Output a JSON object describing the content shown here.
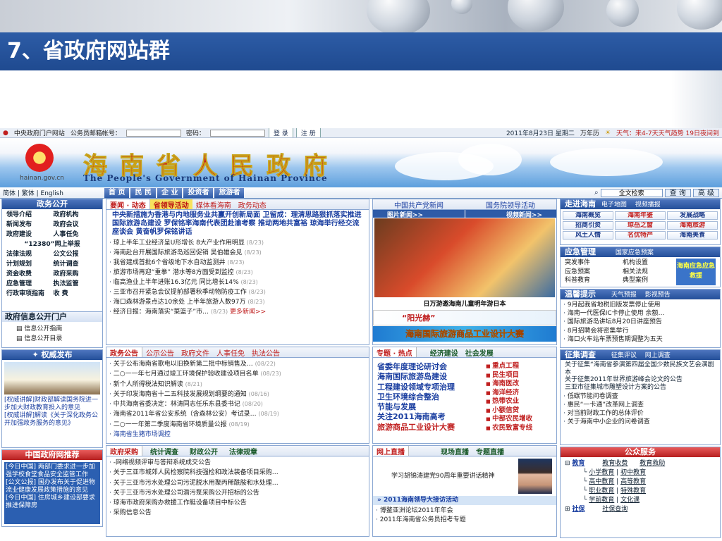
{
  "slide": {
    "title": "7、省政府网站群"
  },
  "topbar": {
    "portal": "中央政府门户网站",
    "account_label": "公务员邮箱帐号：",
    "password_label": "密码：",
    "login": "登 录",
    "register": "注 册",
    "date": "2011年8月23日 星期二",
    "calendar": "万年历",
    "weather": "天气：来4-7天天气趋势 19日夜间到"
  },
  "banner": {
    "url": "hainan.gov.cn",
    "title": "海南省人民政府",
    "subtitle": "The People's Government of Hainan Province"
  },
  "nav": {
    "langs": "简体 | 繁体 | English",
    "tabs": [
      "首 页",
      "民 民",
      "企 业",
      "投资者",
      "旅游者"
    ],
    "search_value": "全文检索",
    "query": "查 询",
    "advanced": "高 级"
  },
  "left": {
    "gov_open": {
      "title": "政务公开",
      "items": [
        "领导介绍",
        "政府机构",
        "新闻发布",
        "政府会议",
        "政府建设",
        "人事任免",
        "“12380”网上举报",
        "",
        "法律法规",
        "公文公报",
        "计划规划",
        "统计调查",
        "资金收费",
        "政府采购",
        "应急管理",
        "执法监管",
        "行政审项指南",
        "收 费"
      ]
    },
    "info_open": {
      "title": "政府信息公开门户",
      "items": [
        "信息公开指南",
        "信息公开目录"
      ]
    },
    "authority": {
      "title": "权威发布",
      "text": "[权威讲解]财政部解读国务院进一步加大财政教育投入的意见",
      "text2": "[权威讲解]解读《关于深化政务公开加强政务服务的意见》"
    },
    "recommend": {
      "title": "中国政府网推荐",
      "text": "[今日中国] 两部门委求进一步加强学校食堂食品安全监管工作",
      "text2": "[公文公报] 国办发布关于促进物流业健康发展政策措施的意见",
      "text3": "[今日中国] 住房城乡建设部要求推进保障房"
    }
  },
  "mid": {
    "news_tabs": {
      "t1": "要闻 · 动态",
      "t2": "省领导活动",
      "t3": "媒体看海南",
      "t4": "政务动态"
    },
    "headline": "中央新措施为香港与内地服务业共赢开创新局面 卫留成：理清思路狠抓落实推进国际旅游岛建设 罗保铭率海南代表团赴渝考察 推动两地共富裕 琼海举行经交流座谈会 黄奋帆罗保铭讲话",
    "news": [
      {
        "t": "琼上半年工业经济呈U形增长 8大产业作用明显",
        "d": "(8/23)"
      },
      {
        "t": "海南赴台开展国际旅游岛巡回促销 吴伯雄会见",
        "d": "(8/23)"
      },
      {
        "t": "我省建成首批6个省级地下水自动监测井",
        "d": "(8/23)"
      },
      {
        "t": "旅游市场再迎“重拳” 潜水等8方面受到监控",
        "d": "(8/23)"
      },
      {
        "t": "临高渔业上半年进账16.3亿元 同比增长14%",
        "d": "(8/23)"
      },
      {
        "t": "三亚市召开紧急会议提前部署秋季动物防疫工作",
        "d": "(8/23)"
      },
      {
        "t": "海口森林游景点达10余处 上半年旅游人数97万",
        "d": "(8/23)"
      },
      {
        "t": "经济日报：海南落实“菜篮子”市…",
        "d": "(8/23)"
      }
    ],
    "more_news": "更多新闻>>",
    "notice_tabs": {
      "t1": "政务公告",
      "t2": "公示公告",
      "t3": "政府文件",
      "t4": "人事任免",
      "t5": "执法公告"
    },
    "notices": [
      {
        "t": "关于公布海南省歌电以旧换新第二批中标销售及…",
        "d": "(08/22)"
      },
      {
        "t": "二○一一年七月通过竣工环境保护验收建设项目名单",
        "d": "(08/23)"
      },
      {
        "t": "新个人所得税法知识解读",
        "d": "(8/21)"
      },
      {
        "t": "关于印发海南省十二五科技发展规划纲要的通知",
        "d": "(08/16)"
      },
      {
        "t": "中共海南省委决定：林涛同志任乐东县委书记",
        "d": "(08/20)"
      },
      {
        "t": "海南省2011年省公安系统（含森林公安）考试录…",
        "d": "(08/19)"
      },
      {
        "t": "二○一一年第二季度海南省环境质量公报",
        "d": "(08/19)"
      },
      {
        "t": "海南省生猪市场调控",
        "d": ""
      }
    ],
    "purchase_tabs": {
      "t1": "政府采购",
      "t2": "统计调查",
      "t3": "财政公开",
      "t4": "法律规章"
    },
    "purchases": [
      "-网络视频评审与答辩系统成交公告",
      "关于三亚市城郊人民检察院科技强检和政法装备项目采购…",
      "关于三亚市污水处理公司污泥脱水用聚丙稀酰胺和水处理…",
      "关于三亚市污水处理公司潜污泵采购公开招标的公告",
      "琼海市政府采购办救援工作艇设备项目中标公告",
      "采购信息公告"
    ]
  },
  "center": {
    "tabs": {
      "t1": "中国共产党新闻",
      "t2": "国务院领导活动"
    },
    "photo_tab": "图片新闻>>",
    "video_tab": "视频新闻>>",
    "photo_caption": "日万游邀海南儿童明年游日本",
    "ad1": "“阳光赫”",
    "ad2": "海南国际旅游商品工业设计大赛",
    "topic_tabs": {
      "t1": "专题 · 热点",
      "t2": "经济建设",
      "t3": "社会发展"
    },
    "topics_left": [
      "省委年度理论研讨会",
      "海南国际旅游岛建设",
      "工程建设领域专项治理",
      "卫生环境综合整治",
      "节能与发展",
      "关注2011海南高考",
      "旅游商品工业设计大赛"
    ],
    "topics_right": [
      "重点工程",
      "民生项目",
      "海南医改",
      "海洋经济",
      "热带农业",
      "小额信贷",
      "中部农民增收",
      "农民致富专线"
    ],
    "live": {
      "title": "网上直播",
      "sub1": "现场直播",
      "sub2": "专题直播",
      "caption": "学习胡锦涛建党90周年重要讲话精神",
      "banner": "2011海南领导大接访活动",
      "items": [
        "博鳌亚洲论坛2011年年会",
        "2011年海南省公务员招考专题"
      ]
    }
  },
  "right": {
    "visit": {
      "title": "走进海南",
      "sub1": "电子地图",
      "sub2": "视频播报",
      "buttons": [
        {
          "l": "海南概览",
          "r": false
        },
        {
          "l": "海南年鉴",
          "r": true
        },
        {
          "l": "发展战略",
          "r": false
        },
        {
          "l": "招商引资",
          "r": false
        },
        {
          "l": "琼岳之窗",
          "r": true
        },
        {
          "l": "海南旅游",
          "r": true
        },
        {
          "l": "风土人情",
          "r": false
        },
        {
          "l": "名优特产",
          "r": true
        },
        {
          "l": "海南美食",
          "r": false
        }
      ]
    },
    "emergency": {
      "title": "应急管理",
      "sub": "国家应急预案",
      "items": [
        "突发事件",
        "机构设置",
        "应急预案",
        "相关法规",
        "科普教育",
        "典型案例"
      ],
      "badge": "海南应急应急救援"
    },
    "tips": {
      "title": "温馨提示",
      "sub1": "天气预报",
      "sub2": "影视预告",
      "items": [
        "9月起我省地税旧版发票停止使用",
        "海南一代医保IC卡停止使用 余额…",
        "国际旅游岛讲坛8月20日讲座预告",
        "8月招聘会将密集举行",
        "海口火车站车票预售期调整为五天"
      ]
    },
    "survey": {
      "title": "征集调查",
      "sub1": "征集评议",
      "sub2": "网上调查",
      "items": [
        "关于征集“海南省参演第四届全国少数民族文艺会演剧本",
        "关于征集2011年世界旅游峰会论文的公告",
        "三亚市征集城市雕塑设计方案的公告",
        "低碳节能问卷调查",
        "惠民“一卡通”改革网上调查",
        "对当前财政工作的总体评价",
        "关于海南中小企业的问卷调查"
      ]
    },
    "service": {
      "title": "公众服务",
      "edu": "教育",
      "edu_tabs": [
        "教育收费",
        "教育救助"
      ],
      "edu_items": [
        "小学教育",
        "初中教育",
        "高中教育",
        "高等教育",
        "职业教育",
        "特殊教育",
        "学前教育",
        "文化课"
      ],
      "social": "社保",
      "social_item": "社保查询"
    }
  }
}
